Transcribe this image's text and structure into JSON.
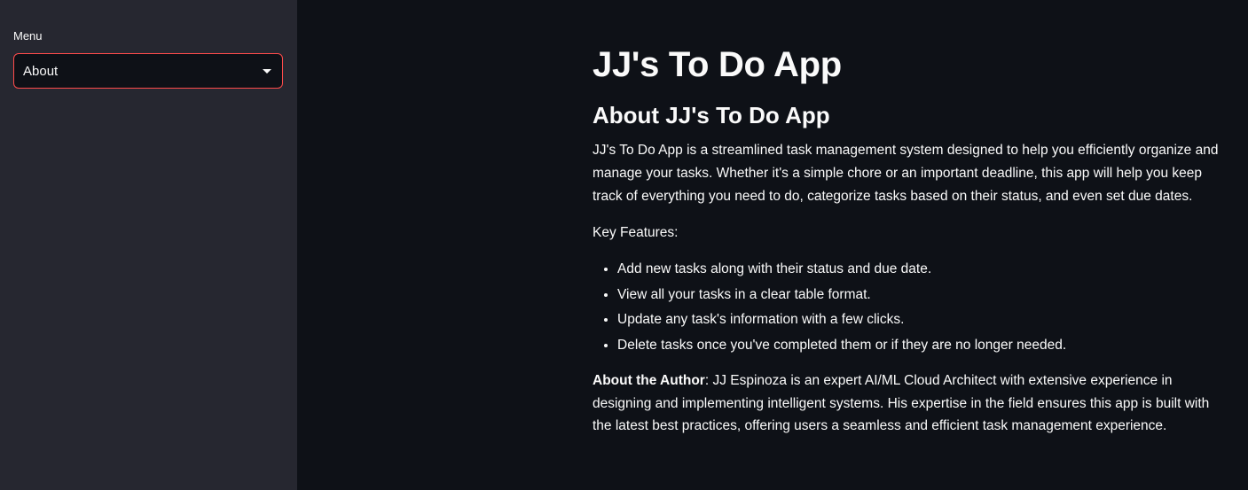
{
  "sidebar": {
    "menu_label": "Menu",
    "select": {
      "value": "About"
    }
  },
  "main": {
    "title": "JJ's To Do App",
    "subtitle": "About JJ's To Do App",
    "intro": "JJ's To Do App is a streamlined task management system designed to help you efficiently organize and manage your tasks. Whether it's a simple chore or an important deadline, this app will help you keep track of everything you need to do, categorize tasks based on their status, and even set due dates.",
    "features_label": "Key Features:",
    "features": [
      "Add new tasks along with their status and due date.",
      "View all your tasks in a clear table format.",
      "Update any task's information with a few clicks.",
      "Delete tasks once you've completed them or if they are no longer needed."
    ],
    "author": {
      "label": "About the Author",
      "text": ": JJ Espinoza is an expert AI/ML Cloud Architect with extensive experience in designing and implementing intelligent systems. His expertise in the field ensures this app is built with the latest best practices, offering users a seamless and efficient task management experience."
    }
  },
  "colors": {
    "sidebar_bg": "#262730",
    "main_bg": "#0e1117",
    "accent": "#ff4b4b",
    "text": "#fafafa"
  },
  "icons": {
    "select_caret": "caret-down-icon"
  }
}
